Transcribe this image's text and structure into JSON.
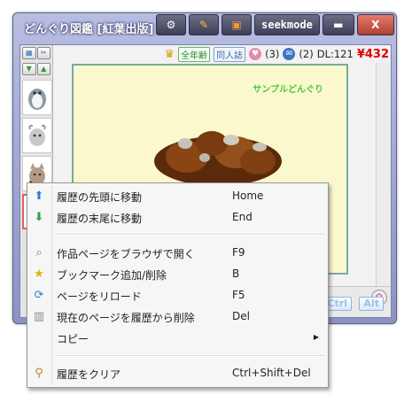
{
  "window": {
    "title": "どんぐり図鑑 [紅葉出版]",
    "mode_button": "seekmode",
    "buttons": {
      "settings_icon": "gear-icon",
      "pin_icon": "pin-icon",
      "lock_icon": "lock-icon",
      "minimize": "▬",
      "close": "X"
    }
  },
  "info_bar": {
    "crown_icon": "crown-icon",
    "badge_all_ages": "全年齢",
    "badge_doujin": "同人誌",
    "likes_count": "(3)",
    "comments_count": "(2)",
    "downloads": "DL:121",
    "price": "¥432"
  },
  "page": {
    "sample_label": "サンプルどんぐり"
  },
  "bottom_keys": {
    "ctrl": "Ctrl",
    "alt": "Alt"
  },
  "context_menu": {
    "items": [
      {
        "label": "履歴の先頭に移動",
        "shortcut": "Home",
        "icon": "arrow-up-icon"
      },
      {
        "label": "履歴の末尾に移動",
        "shortcut": "End",
        "icon": "arrow-down-icon"
      },
      {
        "label": "作品ページをブラウザで開く",
        "shortcut": "F9",
        "icon": "magnifier-icon"
      },
      {
        "label": "ブックマーク追加/削除",
        "shortcut": "B",
        "icon": "star-icon"
      },
      {
        "label": "ページをリロード",
        "shortcut": "F5",
        "icon": "reload-icon"
      },
      {
        "label": "現在のページを履歴から削除",
        "shortcut": "Del",
        "icon": "trash-icon"
      },
      {
        "label": "コピー",
        "shortcut": "",
        "icon": ""
      },
      {
        "label": "履歴をクリア",
        "shortcut": "Ctrl+Shift+Del",
        "icon": "broom-icon"
      }
    ]
  }
}
